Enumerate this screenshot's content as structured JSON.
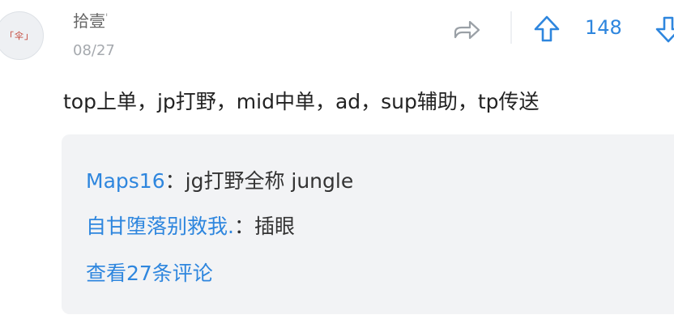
{
  "user": {
    "avatar_text": "「伞」",
    "name": "拾壹",
    "name_mark": "'",
    "date": "08/27"
  },
  "actions": {
    "share_icon": "share-arrow-icon",
    "upvote_icon": "arrow-up-icon",
    "vote_count": "148",
    "downvote_icon": "arrow-down-icon",
    "accent_color": "#2e86de"
  },
  "comment": {
    "text": "top上单，jp打野，mid中单，ad，sup辅助，tp传送"
  },
  "replies": {
    "items": [
      {
        "author": "Maps16",
        "separator": "：",
        "text": "jg打野全称 jungle"
      },
      {
        "author": "自甘堕落别救我.",
        "separator": "：",
        "text": "插眼"
      }
    ],
    "view_more": "查看27条评论"
  }
}
